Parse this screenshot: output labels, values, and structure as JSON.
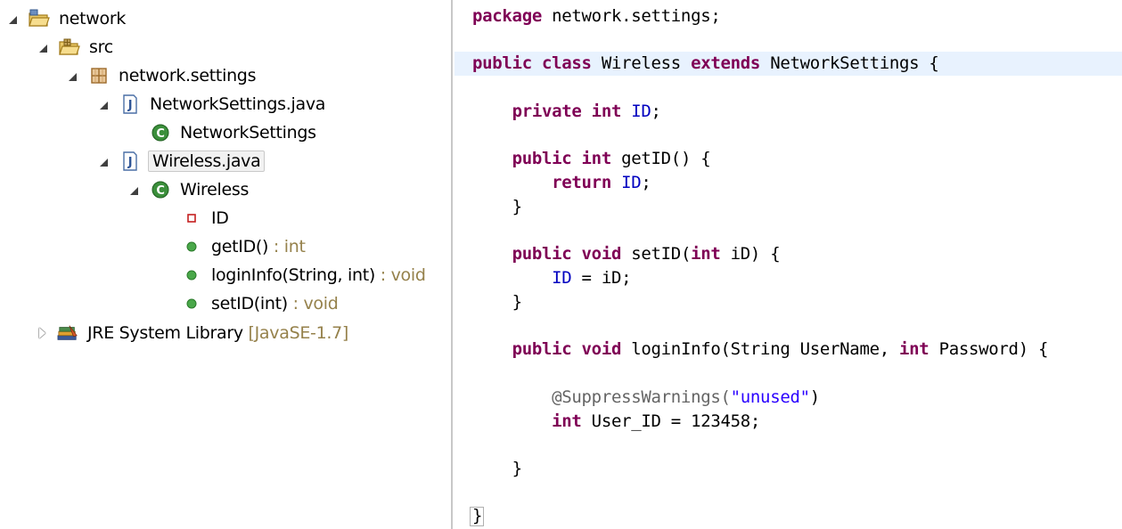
{
  "explorer": {
    "project": "network",
    "src": "src",
    "package": "network.settings",
    "file1": "NetworkSettings.java",
    "class1": "NetworkSettings",
    "file2": "Wireless.java",
    "class2": "Wireless",
    "field": "ID",
    "m1_name": "getID()",
    "m1_type": " : int",
    "m2_name": "loginInfo(String, int)",
    "m2_type": " : void",
    "m3_name": "setID(int)",
    "m3_type": " : void",
    "lib_name": "JRE System Library",
    "lib_ver": " [JavaSE-1.7]"
  },
  "code": {
    "pkg_kw": "package",
    "pkg_rest": " network.settings;",
    "cls_public": "public",
    "cls_class": " class",
    "cls_name": " Wireless ",
    "cls_extends": "extends",
    "cls_rest": " NetworkSettings {",
    "f_private": "private",
    "f_int": " int",
    "f_id": "ID",
    "f_semi": ";",
    "g_public": "public",
    "g_int": " int",
    "g_rest": " getID() {",
    "g_return": "return",
    "g_id": "ID",
    "g_semi": ";",
    "close": "}",
    "s_public": "public",
    "s_void": " void",
    "s_rest1": " setID(",
    "s_int": "int",
    "s_rest2": " iD) {",
    "s_id": "ID",
    "s_rest3": " = iD;",
    "l_public": "public",
    "l_void": " void",
    "l_rest1": " loginInfo(String UserName, ",
    "l_int": "int",
    "l_rest2": " Password) {",
    "l_ann": "@SuppressWarnings(",
    "l_str": "\"unused\"",
    "l_ann_end": ")",
    "l_int2": "int",
    "l_rest3": " User_ID = 123458;",
    "end": "}"
  },
  "colors": {
    "keyword": "#7f0055",
    "field": "#0000c0",
    "string": "#2a00ff",
    "annotation": "#646464",
    "signature": "#95814b",
    "current_line": "#e8f2fe"
  },
  "icons": {
    "project": "project-folder-icon",
    "src": "source-folder-icon",
    "package": "package-icon",
    "java_file": "java-file-icon",
    "class": "class-icon",
    "private_field": "private-field-icon",
    "public_method": "public-method-icon",
    "library": "library-icon"
  }
}
